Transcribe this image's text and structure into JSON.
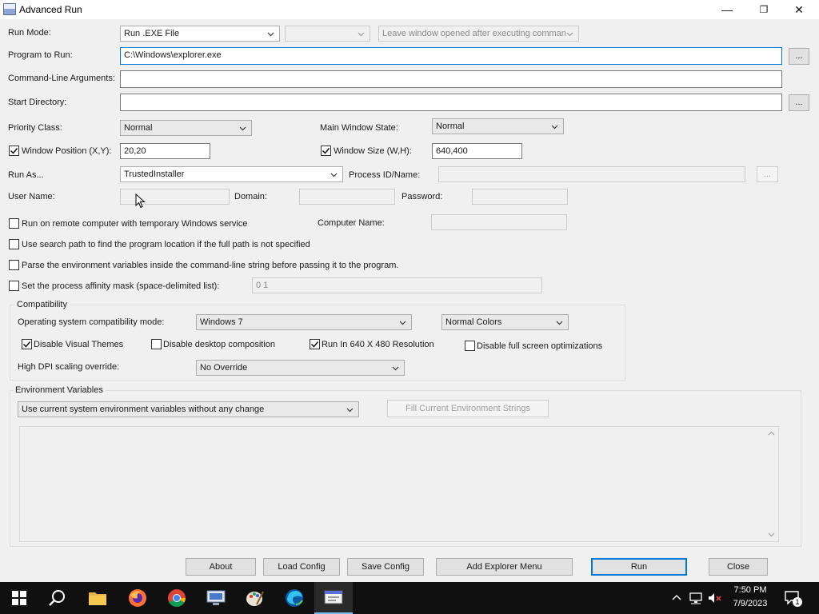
{
  "window": {
    "title": "Advanced Run",
    "minimize": "—",
    "maximize": "❐",
    "close": "✕"
  },
  "form": {
    "run_mode": {
      "label": "Run Mode:",
      "value": "Run .EXE File",
      "secondary_value": "",
      "after_value": "Leave window opened after executing comman"
    },
    "program": {
      "label": "Program to Run:",
      "value": "C:\\Windows\\explorer.exe",
      "browse": "..."
    },
    "args": {
      "label": "Command-Line Arguments:",
      "value": ""
    },
    "start_dir": {
      "label": "Start Directory:",
      "value": "",
      "browse": "..."
    },
    "priority": {
      "label": "Priority Class:",
      "value": "Normal"
    },
    "main_state": {
      "label": "Main Window State:",
      "value": "Normal"
    },
    "window_pos": {
      "label": "Window Position (X,Y):",
      "value": "20,20",
      "checked": true
    },
    "window_size": {
      "label": "Window Size (W,H):",
      "value": "640,400",
      "checked": true
    },
    "run_as": {
      "label": "Run As...",
      "value": "TrustedInstaller"
    },
    "process_id": {
      "label": "Process ID/Name:",
      "value": "",
      "browse": "..."
    },
    "user_name": {
      "label": "User Name:",
      "value": ""
    },
    "domain": {
      "label": "Domain:",
      "value": ""
    },
    "password": {
      "label": "Password:",
      "value": ""
    },
    "remote": {
      "label": "Run on remote computer with temporary Windows service",
      "checked": false
    },
    "computer_name": {
      "label": "Computer Name:",
      "value": ""
    },
    "search_path": {
      "label": "Use search path to find the program location if the full path is not specified",
      "checked": false
    },
    "parse_env": {
      "label": "Parse the environment variables inside the command-line string before passing it to the program.",
      "checked": false
    },
    "affinity": {
      "label": "Set the process affinity mask (space-delimited list):",
      "value": "0 1",
      "checked": false
    }
  },
  "compat": {
    "title": "Compatibility",
    "os_mode_label": "Operating system compatibility mode:",
    "os_mode_value": "Windows 7",
    "colors_value": "Normal Colors",
    "disable_themes": {
      "label": "Disable Visual Themes",
      "checked": true
    },
    "disable_desktop": {
      "label": "Disable desktop composition",
      "checked": false
    },
    "run_640": {
      "label": "Run In 640 X 480 Resolution",
      "checked": true
    },
    "disable_fullscreen": {
      "label": "Disable full screen optimizations",
      "checked": false
    },
    "dpi_label": "High DPI scaling override:",
    "dpi_value": "No Override"
  },
  "env": {
    "title": "Environment Variables",
    "mode_value": "Use current system environment variables without any change",
    "fill_button": "Fill Current Environment Strings",
    "text": ""
  },
  "buttons": {
    "about": "About",
    "load": "Load Config",
    "save": "Save Config",
    "explorer_menu": "Add Explorer Menu",
    "run": "Run",
    "close": "Close"
  },
  "taskbar": {
    "time": "7:50 PM",
    "date": "7/9/2023",
    "notification_count": "1",
    "icons": [
      "windows-start-icon",
      "search-icon",
      "file-explorer-icon",
      "firefox-icon",
      "chrome-icon",
      "remote-desktop-icon",
      "paint-icon",
      "edge-icon",
      "advanced-run-icon"
    ]
  },
  "colors": {
    "accent": "#0078d7",
    "taskbar": "#101010"
  }
}
